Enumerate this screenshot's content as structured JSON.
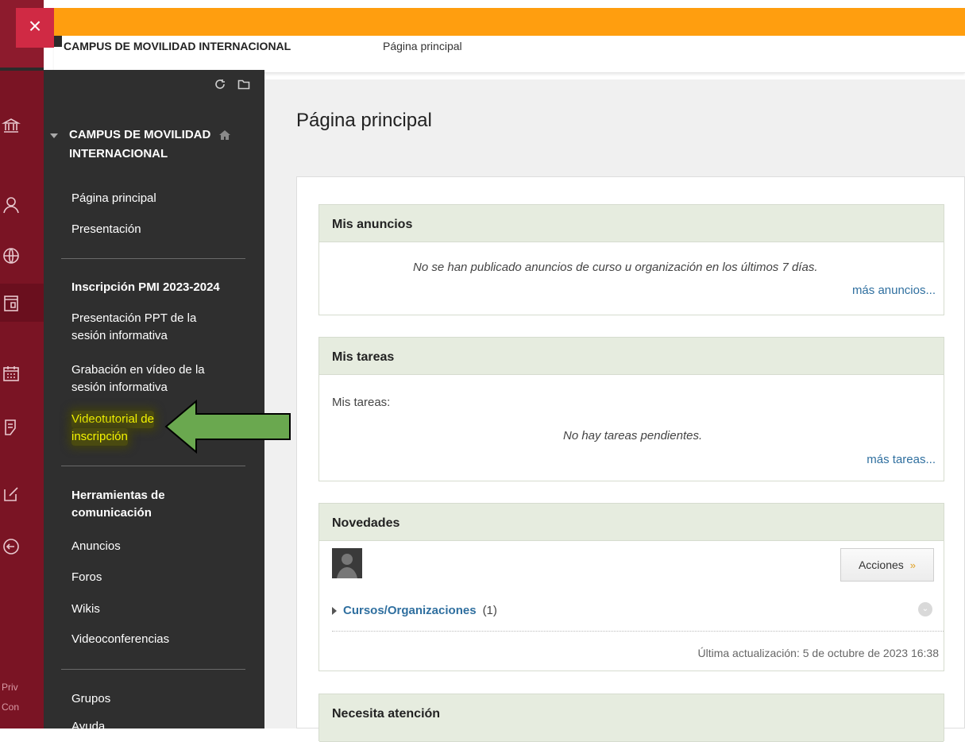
{
  "rail": {
    "close_label": "×",
    "icons": [
      "institution-icon",
      "user-icon",
      "globe-icon",
      "courses-icon",
      "calendar-icon",
      "grades-icon",
      "edit-icon",
      "logout-icon"
    ],
    "footer_line1": "Priv",
    "footer_line2": "Con",
    "accent_color": "#7a1424"
  },
  "header": {
    "course_title": "CAMPUS DE MOVILIDAD INTERNACIONAL",
    "breadcrumb": "Página principal",
    "accent_color": "#ff9e0f"
  },
  "sidebar": {
    "course_name_line1": "CAMPUS DE MOVILIDAD",
    "course_name_line2": "INTERNACIONAL",
    "items": [
      {
        "label": "Página principal"
      },
      {
        "label": "Presentación"
      }
    ],
    "section1_heading": "Inscripción PMI 2023-2024",
    "section1_items": [
      {
        "line1": "Presentación PPT de la",
        "line2": "sesión informativa"
      },
      {
        "line1": "Grabación en vídeo de la",
        "line2": "sesión informativa"
      },
      {
        "line1": "Videotutorial de",
        "line2": "inscripción"
      }
    ],
    "section2_heading_line1": "Herramientas de",
    "section2_heading_line2": "comunicación",
    "section2_items": [
      {
        "label": "Anuncios"
      },
      {
        "label": "Foros"
      },
      {
        "label": "Wikis"
      },
      {
        "label": "Videoconferencias"
      }
    ],
    "section3_items": [
      {
        "label": "Grupos"
      },
      {
        "label": "Ayuda"
      }
    ]
  },
  "main": {
    "page_title": "Página principal",
    "announcements": {
      "title": "Mis anuncios",
      "empty_text": "No se han publicado anuncios de curso u organización en los últimos 7 días.",
      "more_link": "más anuncios..."
    },
    "tasks": {
      "title": "Mis tareas",
      "label": "Mis tareas:",
      "empty_text": "No hay tareas pendientes.",
      "more_link": "más tareas..."
    },
    "news": {
      "title": "Novedades",
      "actions_label": "Acciones",
      "courses_link": "Cursos/Organizaciones",
      "courses_count": "(1)",
      "last_updated": "Última actualización: 5 de octubre de 2023 16:38"
    },
    "attention": {
      "title": "Necesita atención"
    }
  }
}
